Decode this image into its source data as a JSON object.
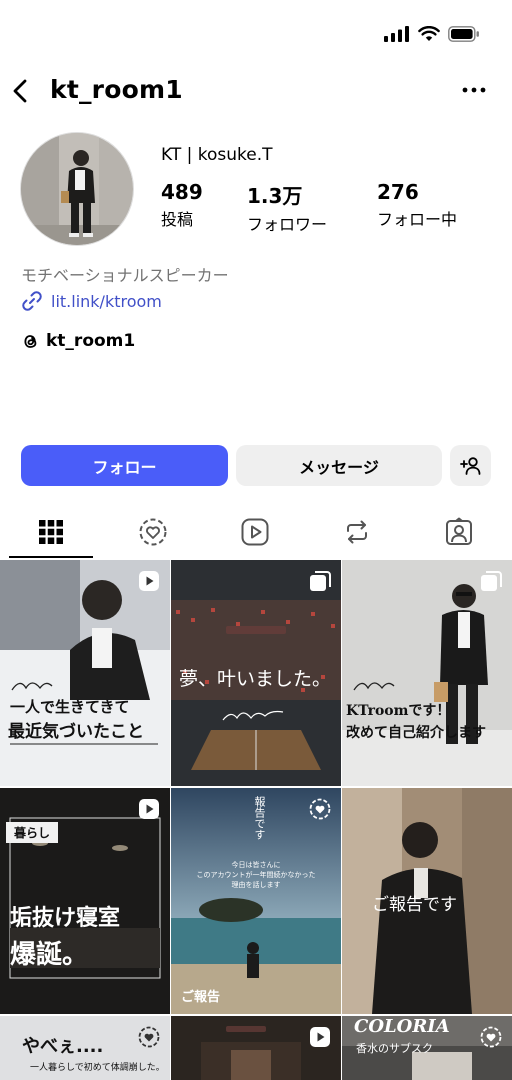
{
  "header": {
    "username": "kt_room1"
  },
  "profile": {
    "display_name": "KT | kosuke.T",
    "stats": [
      {
        "value": "489",
        "label": "投稿"
      },
      {
        "value": "1.3万",
        "label": "フォロワー"
      },
      {
        "value": "276",
        "label": "フォロー中"
      }
    ],
    "bio": "モチベーショナルスピーカー",
    "link": "lit.link/ktroom",
    "threads": "kt_room1"
  },
  "actions": {
    "follow": "フォロー",
    "message": "メッセージ"
  },
  "posts": [
    {
      "line1": "一人で生きてきて",
      "line2": "最近気づいたこと"
    },
    {
      "line1": "夢、叶いました。"
    },
    {
      "line1": "KTroomです！",
      "line2": "改めて自己紹介します"
    },
    {
      "tag": "暮らし",
      "line1": "垢抜け寝室",
      "line2": "爆誕。"
    },
    {
      "v1": "報告です",
      "sub": "今日は皆さんに",
      "sub2": "このアカウントが一年間続かなかった",
      "sub3": "理由を話します",
      "line1": "ご報告"
    },
    {
      "line1": "ご報告です"
    },
    {
      "line1": "やべぇ....",
      "sub": "一人暮らしで初めて体調崩した。"
    },
    {
      "line1": ""
    },
    {
      "line1": "COLORIA",
      "sub": "香水のサブスク"
    }
  ],
  "colors": {
    "accent": "#4a5df9",
    "link": "#4150c8"
  }
}
